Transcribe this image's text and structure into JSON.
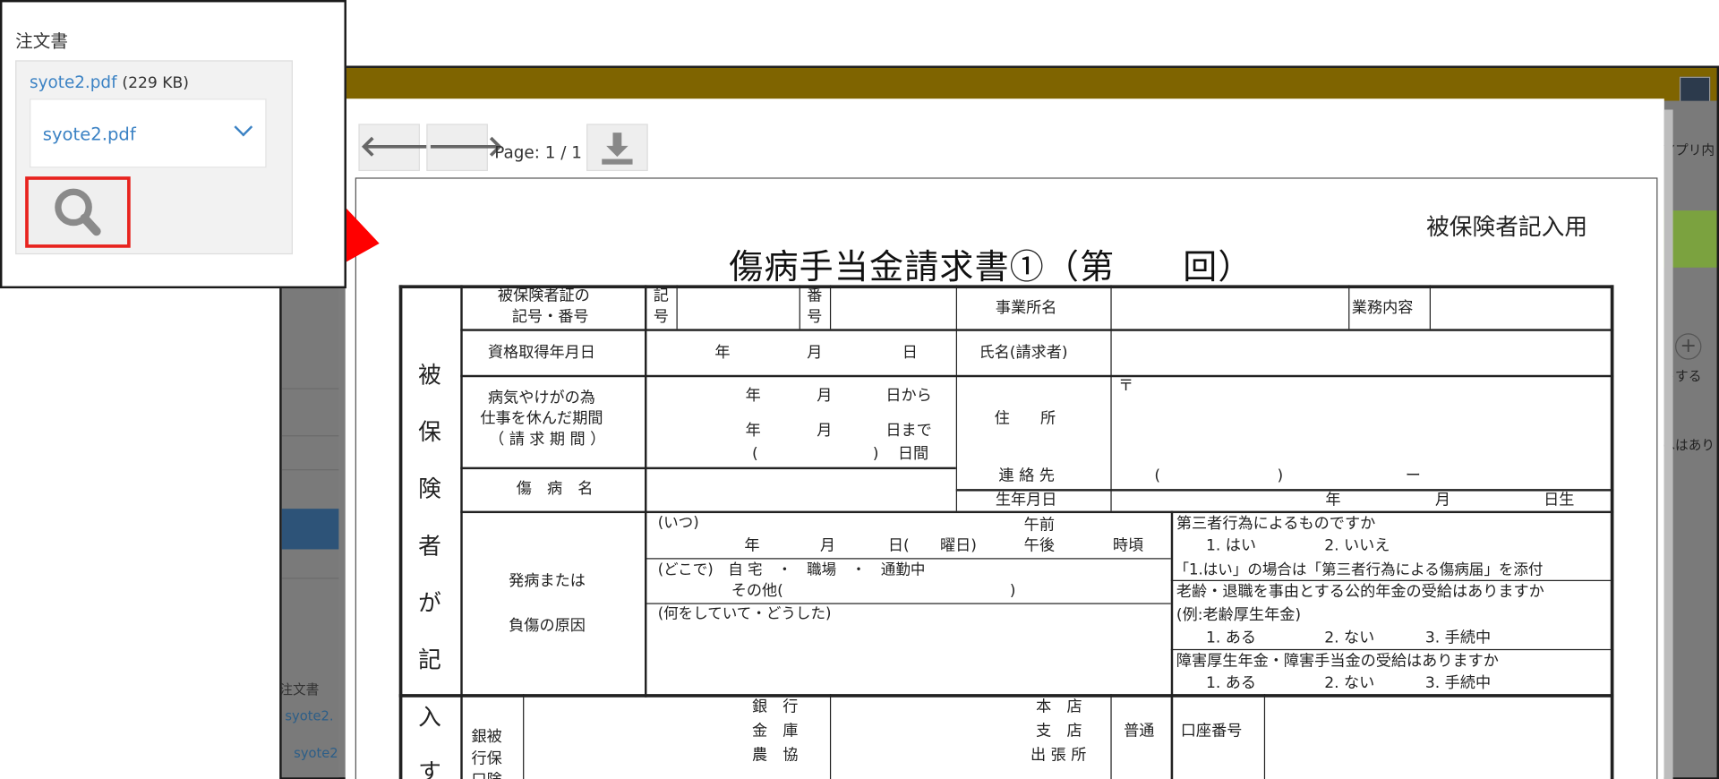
{
  "panel": {
    "title": "注文書",
    "file_link": "syote2.pdf",
    "file_size": "(229 KB)",
    "select_value": "syote2.pdf",
    "search_icon": "search-icon",
    "highlight_color": "#e8231e"
  },
  "background_app": {
    "header_color": "#7f6400",
    "left_labels": [
      "注文書",
      "syote2.",
      "syote2"
    ],
    "right_labels": [
      "アプリ内",
      "トする",
      "へはありま"
    ],
    "plus": "+"
  },
  "viewer": {
    "prev_icon": "arrow-left-icon",
    "next_icon": "arrow-right-icon",
    "download_icon": "download-icon",
    "prev_glyph": "🡐",
    "next_glyph": "🡒",
    "page_info": "Page: 1 / 1"
  },
  "form": {
    "corner_label": "被保険者記入用",
    "title_main": "傷病手当金請求書①（第",
    "title_end": "回）",
    "vertical_label": [
      "被",
      "保",
      "険",
      "者",
      "が",
      "記",
      "入",
      "す"
    ],
    "insurance_card_1": "被保険者証の",
    "insurance_card_2": "記号・番号",
    "kigou_1": "記",
    "kigou_2": "号",
    "bangou_1": "番",
    "bangou_2": "号",
    "office_name": "事業所名",
    "job_content": "業務内容",
    "qualification_date": "資格取得年月日",
    "year": "年",
    "month": "月",
    "day": "日",
    "name_claimant": "氏名(請求者)",
    "leave_1": "病気やけがの為",
    "leave_2": "仕事を休んだ期間",
    "leave_3": "（ 請 求 期 間 ）",
    "day_from": "日から",
    "day_until": "日まで",
    "paren_open": "(",
    "paren_close": ")",
    "days": "日間",
    "postal": "〒",
    "address": "住　　所",
    "contact": "連 絡 先",
    "dash": "ー",
    "illness_name": "傷　病　名",
    "birthdate": "生年月日",
    "born": "日生",
    "onset_1": "発病または",
    "onset_2": "負傷の原因",
    "when": "(いつ)",
    "am": "午前",
    "pm": "午後",
    "dow": "日(　　曜日)",
    "oclock": "時頃",
    "where": "(どこで)　自 宅　・　職場　・　通勤中",
    "other": "その他(",
    "other_close": ")",
    "what": "(何をしていて・どうした)",
    "third_party_q": "第三者行為によるものですか",
    "third_party_yes": "1. はい",
    "third_party_no": "2. いいえ",
    "third_party_note": "「1.はい」の場合は「第三者行為による傷病届」を添付",
    "pension_q": "老齢・退職を事由とする公的年金の受給はありますか",
    "pension_ex": "(例:老齢厚生年金)",
    "opt_yes": "1. ある",
    "opt_no": "2. ない",
    "opt_pending": "3. 手続中",
    "disability_q": "障害厚生年金・障害手当金の受給はありますか",
    "bank_1": "銀　行",
    "bank_2": "金　庫",
    "bank_3": "農　協",
    "branch_1": "本　店",
    "branch_2": "支　店",
    "branch_3": "出 張 所",
    "ordinary": "普通",
    "account_number": "口座番号",
    "bank_v1": "銀被",
    "bank_v2": "行保",
    "bank_v3": "口険"
  }
}
